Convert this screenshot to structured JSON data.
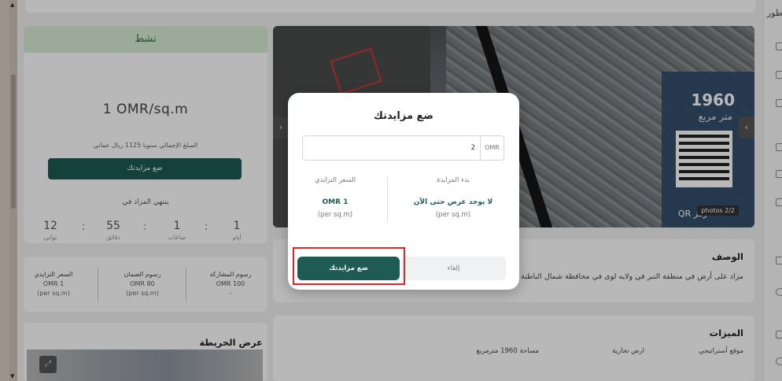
{
  "sidebar_right": {
    "title": "تطور"
  },
  "status_card": {
    "status": "نشط",
    "price": "1 OMR/sq.m",
    "annual_total": "المبلغ الإجمالي سنويا 1125 ريال عماني",
    "bid_button": "ضع مزايدتك",
    "ends_label": "ينتهي المزاد في",
    "countdown": [
      {
        "value": "1",
        "unit": "أيام"
      },
      {
        "value": "1",
        "unit": "ساعات"
      },
      {
        "value": "55",
        "unit": "دقائق"
      },
      {
        "value": "12",
        "unit": "ثواني"
      }
    ]
  },
  "fees": [
    {
      "title": "رسوم المشاركة",
      "value": "OMR 100",
      "sub": "-"
    },
    {
      "title": "رسوم الضمان",
      "value": "OMR 80",
      "sub": "(per sq.m)"
    },
    {
      "title": "السعر التزايدي",
      "value": "OMR 1",
      "sub": "(per sq.m)"
    }
  ],
  "map_card": {
    "title": "عرض الخريطة"
  },
  "hero": {
    "area_number": "1960",
    "area_unit": "متر مربع",
    "qr_label": "QR رمز",
    "photos_counter": "photos 2/2"
  },
  "description": {
    "title": "الوصف",
    "text": "مزاد على أرض في منطقة النبر في ولايه لوى في محافظة شمال الباطنة"
  },
  "features": {
    "title": "الميزات",
    "items": [
      "موقع أستراتيجي",
      "ارض تجارية",
      "مساحة 1960 مترمربع"
    ]
  },
  "modal": {
    "title": "ضع مزايدتك",
    "input_value": "2",
    "currency": "OMR",
    "start_label": "بدء المزايدة",
    "start_value": "لا يوجد عرض حتى الآن",
    "start_sub": "(per sq.m)",
    "inc_label": "السعر التزايدي",
    "inc_value": "OMR 1",
    "inc_sub": "(per sq.m)",
    "cancel": "إلغاء",
    "submit": "ضع مزايدتك"
  }
}
